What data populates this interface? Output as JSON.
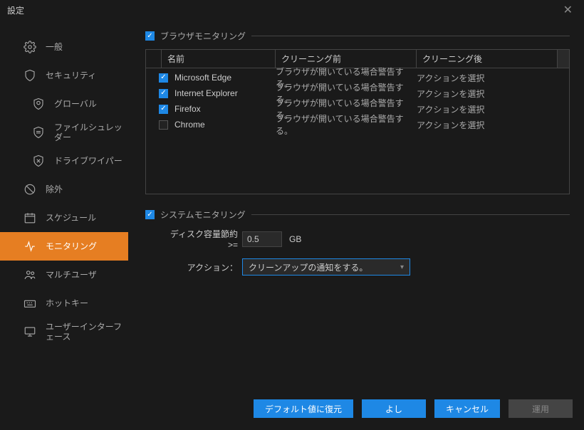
{
  "window": {
    "title": "設定"
  },
  "sidebar": {
    "items": [
      {
        "label": "一般"
      },
      {
        "label": "セキュリティ"
      },
      {
        "label": "グローバル"
      },
      {
        "label": "ファイルシュレッダー"
      },
      {
        "label": "ドライブワイパー"
      },
      {
        "label": "除外"
      },
      {
        "label": "スケジュール"
      },
      {
        "label": "モニタリング"
      },
      {
        "label": "マルチユーザ"
      },
      {
        "label": "ホットキー"
      },
      {
        "label": "ユーザーインターフェース"
      }
    ]
  },
  "browser_monitoring": {
    "title": "ブラウザモニタリング",
    "checked": true,
    "columns": {
      "name": "名前",
      "before": "クリーニング前",
      "after": "クリーニング後"
    },
    "rows": [
      {
        "checked": true,
        "name": "Microsoft Edge",
        "before": "ブラウザが開いている場合警告する。",
        "after": "アクションを選択"
      },
      {
        "checked": true,
        "name": "Internet Explorer",
        "before": "ブラウザが開いている場合警告する。",
        "after": "アクションを選択"
      },
      {
        "checked": true,
        "name": "Firefox",
        "before": "ブラウザが開いている場合警告する。",
        "after": "アクションを選択"
      },
      {
        "checked": false,
        "name": "Chrome",
        "before": "ブラウザが開いている場合警告する。",
        "after": "アクションを選択"
      }
    ]
  },
  "system_monitoring": {
    "title": "システムモニタリング",
    "checked": true,
    "disk_label": "ディスク容量節約  >=",
    "disk_value": "0.5",
    "disk_unit": "GB",
    "action_label": "アクション：",
    "action_value": "クリーンアップの通知をする。"
  },
  "footer": {
    "restore": "デフォルト値に復元",
    "ok": "よし",
    "cancel": "キャンセル",
    "apply": "運用"
  }
}
